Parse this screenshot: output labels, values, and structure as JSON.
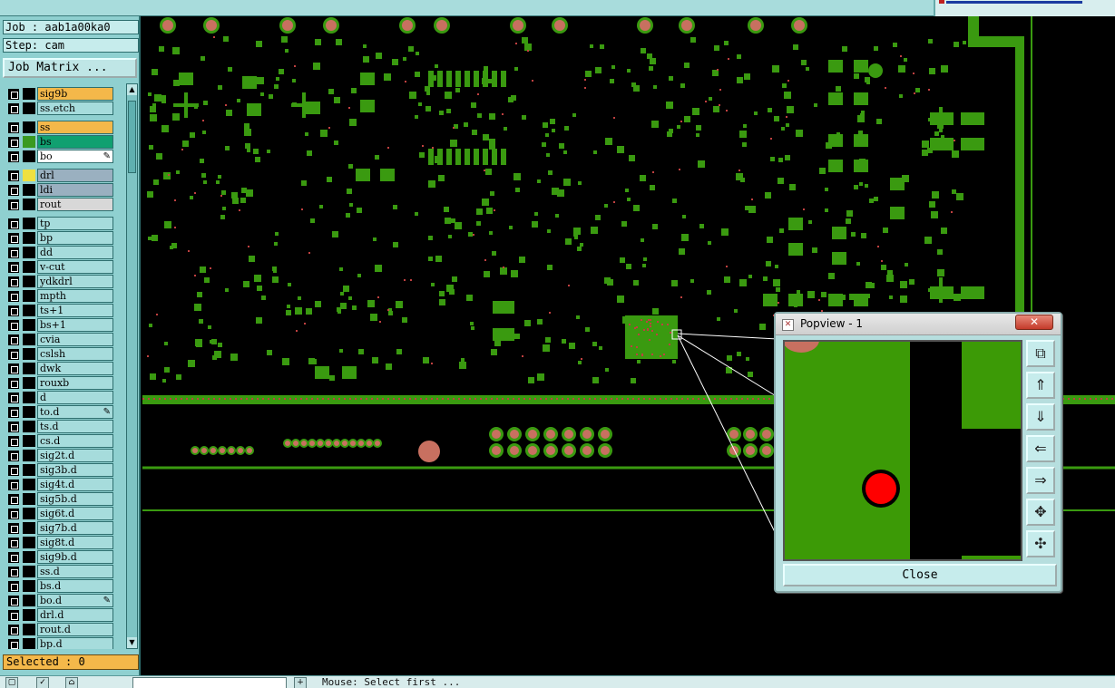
{
  "header": {
    "job_label": "Job : aab1a00ka0",
    "step_label": "Step: cam",
    "matrix_button": "Job Matrix ..."
  },
  "layers": [
    {
      "name": "sig9b",
      "color": "#f4b84a",
      "swatch": "#000000",
      "mark": ""
    },
    {
      "name": "ss.etch",
      "color": "#a6dcdc",
      "swatch": "#000000",
      "mark": ""
    },
    {
      "name": "ss",
      "color": "#f4b84a",
      "swatch": "#000000",
      "mark": ""
    },
    {
      "name": "bs",
      "color": "#10a070",
      "swatch": "#3a9a20",
      "mark": ""
    },
    {
      "name": "bo",
      "color": "#ffffff",
      "swatch": "#000000",
      "mark": "✎"
    },
    {
      "name": "drl",
      "color": "#9ab0c0",
      "swatch": "#f0e040",
      "mark": ""
    },
    {
      "name": "ldi",
      "color": "#9ab0c0",
      "swatch": "#000000",
      "mark": ""
    },
    {
      "name": "rout",
      "color": "#d8d8d8",
      "swatch": "#000000",
      "mark": ""
    },
    {
      "name": "tp",
      "color": "#a6dcdc",
      "swatch": "#000000",
      "mark": ""
    },
    {
      "name": "bp",
      "color": "#a6dcdc",
      "swatch": "#000000",
      "mark": ""
    },
    {
      "name": "dd",
      "color": "#a6dcdc",
      "swatch": "#000000",
      "mark": ""
    },
    {
      "name": "v-cut",
      "color": "#a6dcdc",
      "swatch": "#000000",
      "mark": ""
    },
    {
      "name": "ydkdrl",
      "color": "#a6dcdc",
      "swatch": "#000000",
      "mark": ""
    },
    {
      "name": "mpth",
      "color": "#a6dcdc",
      "swatch": "#000000",
      "mark": ""
    },
    {
      "name": "ts+1",
      "color": "#a6dcdc",
      "swatch": "#000000",
      "mark": ""
    },
    {
      "name": "bs+1",
      "color": "#a6dcdc",
      "swatch": "#000000",
      "mark": ""
    },
    {
      "name": "cvia",
      "color": "#a6dcdc",
      "swatch": "#000000",
      "mark": ""
    },
    {
      "name": "cslsh",
      "color": "#a6dcdc",
      "swatch": "#000000",
      "mark": ""
    },
    {
      "name": "dwk",
      "color": "#a6dcdc",
      "swatch": "#000000",
      "mark": ""
    },
    {
      "name": "rouxb",
      "color": "#a6dcdc",
      "swatch": "#000000",
      "mark": ""
    },
    {
      "name": "d",
      "color": "#a6dcdc",
      "swatch": "#000000",
      "mark": ""
    },
    {
      "name": "to.d",
      "color": "#a6dcdc",
      "swatch": "#000000",
      "mark": "✎"
    },
    {
      "name": "ts.d",
      "color": "#a6dcdc",
      "swatch": "#000000",
      "mark": ""
    },
    {
      "name": "cs.d",
      "color": "#a6dcdc",
      "swatch": "#000000",
      "mark": ""
    },
    {
      "name": "sig2t.d",
      "color": "#a6dcdc",
      "swatch": "#000000",
      "mark": ""
    },
    {
      "name": "sig3b.d",
      "color": "#a6dcdc",
      "swatch": "#000000",
      "mark": ""
    },
    {
      "name": "sig4t.d",
      "color": "#a6dcdc",
      "swatch": "#000000",
      "mark": ""
    },
    {
      "name": "sig5b.d",
      "color": "#a6dcdc",
      "swatch": "#000000",
      "mark": ""
    },
    {
      "name": "sig6t.d",
      "color": "#a6dcdc",
      "swatch": "#000000",
      "mark": ""
    },
    {
      "name": "sig7b.d",
      "color": "#a6dcdc",
      "swatch": "#000000",
      "mark": ""
    },
    {
      "name": "sig8t.d",
      "color": "#a6dcdc",
      "swatch": "#000000",
      "mark": ""
    },
    {
      "name": "sig9b.d",
      "color": "#a6dcdc",
      "swatch": "#000000",
      "mark": ""
    },
    {
      "name": "ss.d",
      "color": "#a6dcdc",
      "swatch": "#000000",
      "mark": ""
    },
    {
      "name": "bs.d",
      "color": "#a6dcdc",
      "swatch": "#000000",
      "mark": ""
    },
    {
      "name": "bo.d",
      "color": "#a6dcdc",
      "swatch": "#000000",
      "mark": "✎"
    },
    {
      "name": "drl.d",
      "color": "#a6dcdc",
      "swatch": "#000000",
      "mark": ""
    },
    {
      "name": "rout.d",
      "color": "#a6dcdc",
      "swatch": "#000000",
      "mark": ""
    },
    {
      "name": "bp.d",
      "color": "#a6dcdc",
      "swatch": "#000000",
      "mark": ""
    }
  ],
  "selected_label": "Selected : 0",
  "status": {
    "message": "Mouse: Select first ..."
  },
  "popview": {
    "title": "Popview - 1",
    "close_label": "Close",
    "tools": [
      "zoom-window-icon",
      "pan-up-icon",
      "pan-down-icon",
      "pan-left-icon",
      "pan-right-icon",
      "zoom-in-icon",
      "zoom-out-icon"
    ]
  },
  "colors": {
    "panel": "#8fd0d0",
    "copper": "#3a9a10",
    "pad": "#c87060",
    "highlight_drill": "#ff0000",
    "orange_layer": "#f4b84a"
  }
}
